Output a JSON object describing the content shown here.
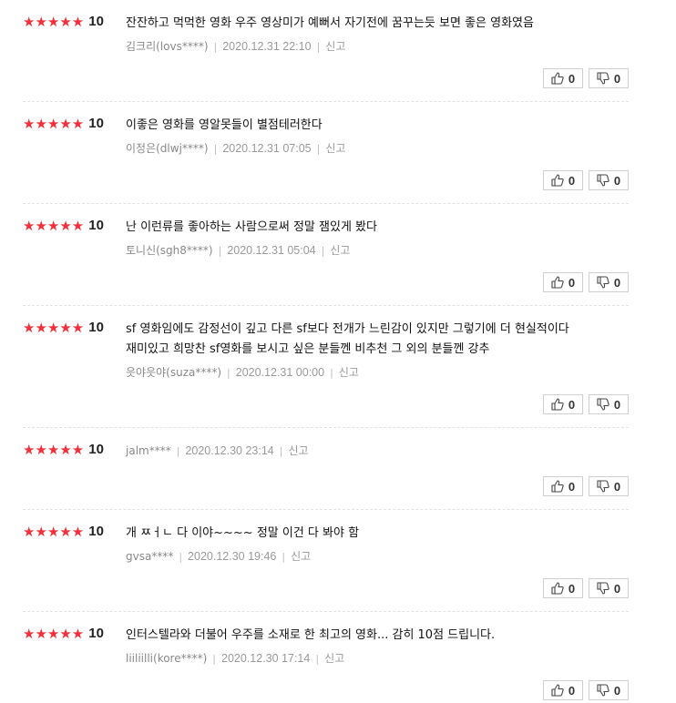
{
  "reviews": [
    {
      "stars": "★★★★★",
      "score": "10",
      "lines": [
        "잔잔하고 먹먹한 영화 우주 영상미가 예뻐서 자기전에 꿈꾸는듯 보면 좋은 영화였음"
      ],
      "author": "김크리(lovs****)",
      "date": "2020.12.31 22:10",
      "report": "신고",
      "likes": "0",
      "dislikes": "0"
    },
    {
      "stars": "★★★★★",
      "score": "10",
      "lines": [
        "이좋은 영화를 영알못들이 별점테러한다"
      ],
      "author": "이정은(dlwj****)",
      "date": "2020.12.31 07:05",
      "report": "신고",
      "likes": "0",
      "dislikes": "0"
    },
    {
      "stars": "★★★★★",
      "score": "10",
      "lines": [
        "난 이런류를 좋아하는 사람으로써 정말 잼있게 봤다"
      ],
      "author": "토니신(sgh8****)",
      "date": "2020.12.31 05:04",
      "report": "신고",
      "likes": "0",
      "dislikes": "0"
    },
    {
      "stars": "★★★★★",
      "score": "10",
      "lines": [
        "sf 영화임에도 감정선이 깊고 다른 sf보다 전개가 느린감이 있지만 그렇기에 더 현실적이다",
        "재미있고 희망찬 sf영화를 보시고 싶은 분들껜 비추천 그 외의 분들껜 강추"
      ],
      "author": "읏야읏야(suza****)",
      "date": "2020.12.31 00:00",
      "report": "신고",
      "likes": "0",
      "dislikes": "0"
    },
    {
      "stars": "★★★★★",
      "score": "10",
      "lines": [],
      "author": "jalm****",
      "date": "2020.12.30 23:14",
      "report": "신고",
      "likes": "0",
      "dislikes": "0"
    },
    {
      "stars": "★★★★★",
      "score": "10",
      "lines": [
        "개 ㅉㅓㄴ 다 이야~~~~ 정말 이건 다 봐야 함"
      ],
      "author": "gvsa****",
      "date": "2020.12.30 19:46",
      "report": "신고",
      "likes": "0",
      "dislikes": "0"
    },
    {
      "stars": "★★★★★",
      "score": "10",
      "lines": [
        "인터스텔라와 더불어 우주를 소재로 한 최고의 영화... 감히 10점 드립니다."
      ],
      "author": "liiliilli(kore****)",
      "date": "2020.12.30 17:14",
      "report": "신고",
      "likes": "0",
      "dislikes": "0"
    }
  ],
  "colors": {
    "star": "#f0313c",
    "border": "#cfcfcf",
    "meta": "#888888"
  },
  "icons": {
    "like": "thumbs-up-icon",
    "dislike": "thumbs-down-icon"
  }
}
